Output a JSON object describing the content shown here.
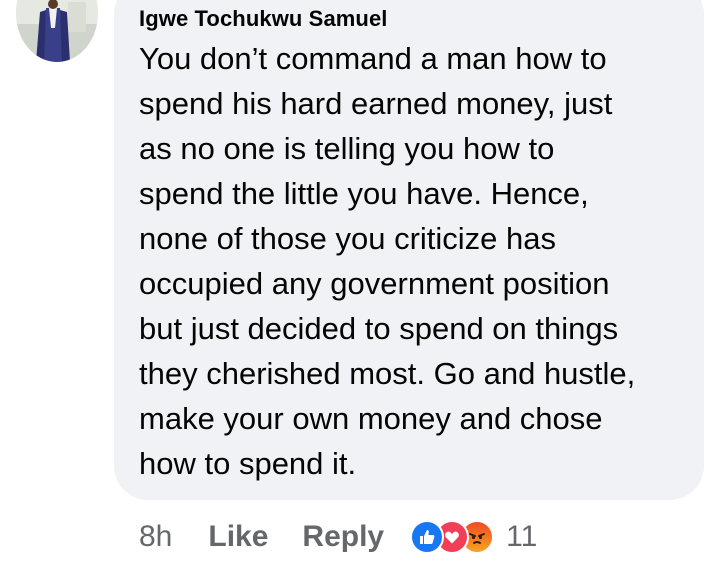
{
  "comment": {
    "author": "Igwe Tochukwu Samuel",
    "lines": [
      "You don’t command a man how to",
      "spend his hard earned money, just",
      "as no one is telling you how to",
      "spend the little you have. Hence,",
      "none of those you criticize has",
      "occupied any government position",
      "but just decided to spend on things",
      "they cherished most. Go and hustle,",
      "make your own money and chose",
      "how to spend it."
    ]
  },
  "actions": {
    "time": "8h",
    "like_label": "Like",
    "reply_label": "Reply",
    "reaction_count": "11",
    "reaction_icons": [
      "like-icon",
      "love-icon",
      "angry-icon"
    ]
  },
  "colors": {
    "bubble": "#f0f2f5",
    "text": "#050505",
    "secondary": "#65676b",
    "like_blue": "#1877f2",
    "love_red": "#f33e58"
  }
}
